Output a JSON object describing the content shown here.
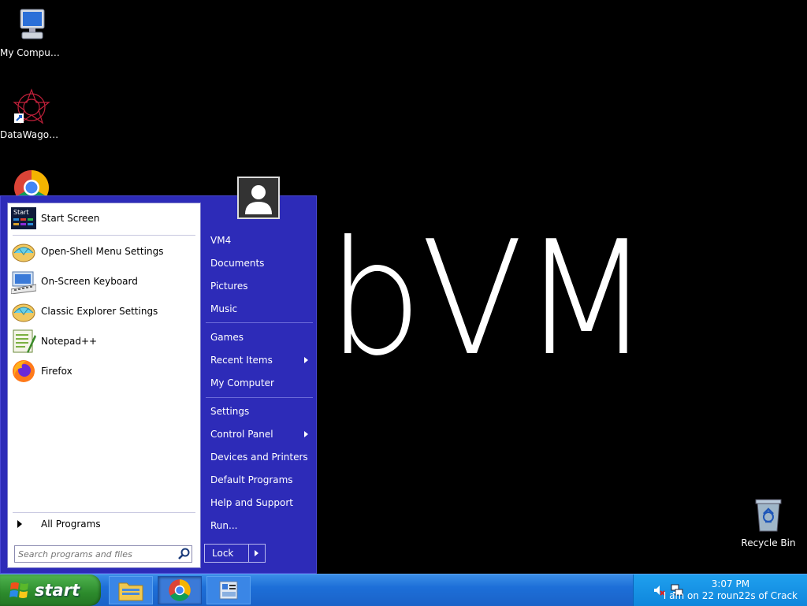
{
  "desktop": {
    "icons": [
      {
        "label": "My Computer"
      },
      {
        "label": "DataWagon..."
      },
      {
        "label": "Recycle Bin"
      }
    ],
    "watermark_dim": "l",
    "watermark": "abVM"
  },
  "start_menu": {
    "left_items": [
      {
        "label": "Start Screen",
        "icon": "start-screen-icon"
      },
      {
        "label": "Open-Shell Menu Settings",
        "icon": "shell-icon"
      },
      {
        "label": "On-Screen Keyboard",
        "icon": "keyboard-icon"
      },
      {
        "label": "Classic Explorer Settings",
        "icon": "shell-icon"
      },
      {
        "label": "Notepad++",
        "icon": "notepad-icon"
      },
      {
        "label": "Firefox",
        "icon": "firefox-icon"
      }
    ],
    "start_screen_badge": "Start",
    "all_programs": "All Programs",
    "search_placeholder": "Search programs and files",
    "right_items": [
      {
        "label": "VM4"
      },
      {
        "label": "Documents"
      },
      {
        "label": "Pictures"
      },
      {
        "label": "Music"
      },
      {
        "label": "Games"
      },
      {
        "label": "Recent Items"
      },
      {
        "label": "My Computer"
      },
      {
        "label": "Settings"
      },
      {
        "label": "Control Panel"
      },
      {
        "label": "Devices and Printers"
      },
      {
        "label": "Default Programs"
      },
      {
        "label": "Help and Support"
      },
      {
        "label": "Run..."
      }
    ],
    "lock_label": "Lock"
  },
  "taskbar": {
    "start_label": "start",
    "time": "3:07 PM",
    "status": "I am on 22 roun22s of Crack"
  },
  "colors": {
    "menu_blue": "#2d2bb8",
    "taskbar_blue": "#1d6fd8",
    "start_green": "#2c8a2c"
  }
}
